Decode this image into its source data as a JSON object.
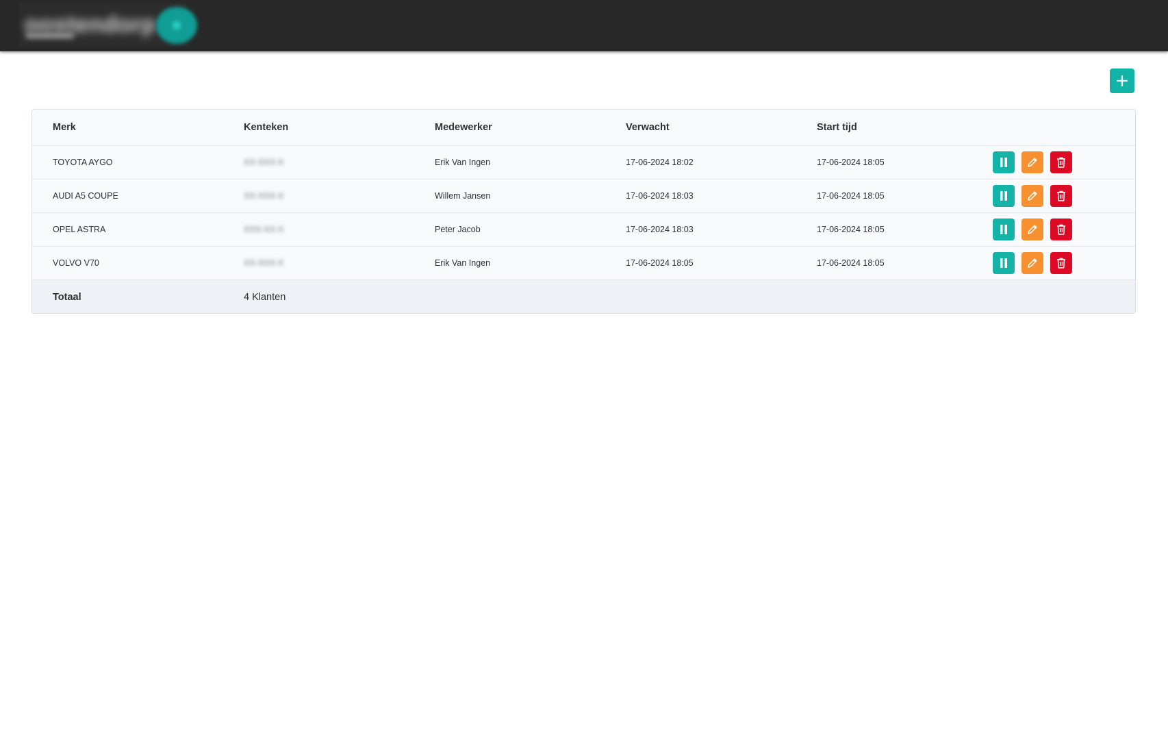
{
  "header": {
    "logo_text": "oostendorp"
  },
  "toolbar": {
    "add_icon": "plus-icon",
    "accent_color": "#14b3a7"
  },
  "table": {
    "columns": [
      "Merk",
      "Kenteken",
      "Medewerker",
      "Verwacht",
      "Start tijd"
    ],
    "rows": [
      {
        "merk": "TOYOTA AYGO",
        "kenteken": "XX-XXX-X",
        "medewerker": "Erik Van Ingen",
        "verwacht": "17-06-2024 18:02",
        "start_tijd": "17-06-2024 18:05"
      },
      {
        "merk": "AUDI A5 COUPE",
        "kenteken": "XX-XXX-X",
        "medewerker": "Willem Jansen",
        "verwacht": "17-06-2024 18:03",
        "start_tijd": "17-06-2024 18:05"
      },
      {
        "merk": "OPEL ASTRA",
        "kenteken": "XXX-XX-X",
        "medewerker": "Peter Jacob",
        "verwacht": "17-06-2024 18:03",
        "start_tijd": "17-06-2024 18:05"
      },
      {
        "merk": "VOLVO V70",
        "kenteken": "XX-XXX-X",
        "medewerker": "Erik Van Ingen",
        "verwacht": "17-06-2024 18:05",
        "start_tijd": "17-06-2024 18:05"
      }
    ],
    "actions": {
      "pause_icon": "pause-icon",
      "edit_icon": "pencil-icon",
      "delete_icon": "trash-icon",
      "pause_color": "#14b3a7",
      "edit_color": "#f7902f",
      "delete_color": "#dc0a24"
    },
    "footer": {
      "label": "Totaal",
      "value": "4 Klanten"
    }
  }
}
